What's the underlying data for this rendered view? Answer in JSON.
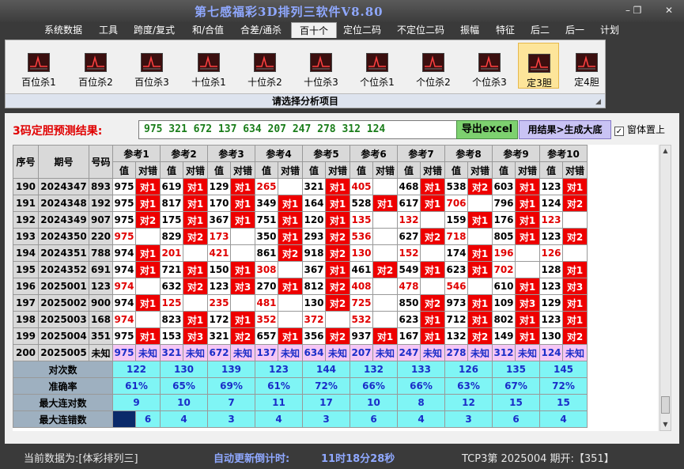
{
  "window": {
    "title": "第七感福彩3D排列三软件V8.80",
    "minimize": "–",
    "restore": "❐",
    "close": "✕"
  },
  "menu": [
    "系统数据",
    "工具",
    "跨度/复式",
    "和/合值",
    "合差/通杀",
    "百十个",
    "定位二码",
    "不定位二码",
    "振幅",
    "特征",
    "后二",
    "后一",
    "计划"
  ],
  "menu_active": 5,
  "tools": [
    "百位杀1",
    "百位杀2",
    "百位杀3",
    "十位杀1",
    "十位杀2",
    "十位杀3",
    "个位杀1",
    "个位杀2",
    "个位杀3",
    "定3胆",
    "定4胆"
  ],
  "tool_selected": 9,
  "toolbar_caption": "请选择分析项目",
  "prediction": {
    "label": "3码定胆预测结果:",
    "value": "975 321 672 137 634 207 247 278 312 124",
    "excel_button": "导出excel",
    "big_button": "用结果>生成大底",
    "pin_label": "窗体置上",
    "pin_checked": "✓"
  },
  "grid": {
    "headers": {
      "seq": "序号",
      "period": "期号",
      "number": "号码",
      "refs": [
        "参考1",
        "参考2",
        "参考3",
        "参考4",
        "参考5",
        "参考6",
        "参考7",
        "参考8",
        "参考9",
        "参考10"
      ],
      "val": "值",
      "hit": "对错"
    },
    "rows": [
      {
        "seq": "190",
        "period": "2024347",
        "number": "893",
        "cells": [
          [
            "975",
            "b",
            "对1",
            "r"
          ],
          [
            "619",
            "b",
            "对1",
            "r"
          ],
          [
            "129",
            "b",
            "对1",
            "r"
          ],
          [
            "265",
            "r",
            "",
            ""
          ],
          [
            "321",
            "b",
            "对1",
            "r"
          ],
          [
            "405",
            "r",
            "",
            ""
          ],
          [
            "468",
            "b",
            "对1",
            "r"
          ],
          [
            "538",
            "b",
            "对2",
            "r"
          ],
          [
            "603",
            "b",
            "对1",
            "r"
          ],
          [
            "123",
            "b",
            "对1",
            "r"
          ]
        ]
      },
      {
        "seq": "191",
        "period": "2024348",
        "number": "192",
        "cells": [
          [
            "975",
            "b",
            "对1",
            "r"
          ],
          [
            "817",
            "b",
            "对1",
            "r"
          ],
          [
            "170",
            "b",
            "对1",
            "r"
          ],
          [
            "349",
            "b",
            "对1",
            "r"
          ],
          [
            "164",
            "b",
            "对1",
            "r"
          ],
          [
            "528",
            "b",
            "对1",
            "r"
          ],
          [
            "617",
            "b",
            "对1",
            "r"
          ],
          [
            "706",
            "r",
            "",
            ""
          ],
          [
            "796",
            "b",
            "对1",
            "r"
          ],
          [
            "124",
            "b",
            "对2",
            "r"
          ]
        ]
      },
      {
        "seq": "192",
        "period": "2024349",
        "number": "907",
        "cells": [
          [
            "975",
            "b",
            "对2",
            "r"
          ],
          [
            "175",
            "b",
            "对1",
            "r"
          ],
          [
            "367",
            "b",
            "对1",
            "r"
          ],
          [
            "751",
            "b",
            "对1",
            "r"
          ],
          [
            "120",
            "b",
            "对1",
            "r"
          ],
          [
            "135",
            "r",
            "",
            ""
          ],
          [
            "132",
            "r",
            "",
            ""
          ],
          [
            "159",
            "b",
            "对1",
            "r"
          ],
          [
            "176",
            "b",
            "对1",
            "r"
          ],
          [
            "123",
            "r",
            "",
            ""
          ]
        ]
      },
      {
        "seq": "193",
        "period": "2024350",
        "number": "220",
        "cells": [
          [
            "975",
            "r",
            "",
            ""
          ],
          [
            "829",
            "b",
            "对2",
            "r"
          ],
          [
            "173",
            "r",
            "",
            ""
          ],
          [
            "350",
            "b",
            "对1",
            "r"
          ],
          [
            "293",
            "b",
            "对2",
            "r"
          ],
          [
            "536",
            "r",
            "",
            ""
          ],
          [
            "627",
            "b",
            "对2",
            "r"
          ],
          [
            "718",
            "r",
            "",
            ""
          ],
          [
            "805",
            "b",
            "对1",
            "r"
          ],
          [
            "123",
            "b",
            "对2",
            "r"
          ]
        ]
      },
      {
        "seq": "194",
        "period": "2024351",
        "number": "788",
        "cells": [
          [
            "974",
            "b",
            "对1",
            "r"
          ],
          [
            "201",
            "r",
            "",
            ""
          ],
          [
            "421",
            "r",
            "",
            ""
          ],
          [
            "861",
            "b",
            "对2",
            "r"
          ],
          [
            "918",
            "b",
            "对2",
            "r"
          ],
          [
            "130",
            "r",
            "",
            ""
          ],
          [
            "152",
            "r",
            "",
            ""
          ],
          [
            "174",
            "b",
            "对1",
            "r"
          ],
          [
            "196",
            "r",
            "",
            ""
          ],
          [
            "126",
            "r",
            "",
            ""
          ]
        ]
      },
      {
        "seq": "195",
        "period": "2024352",
        "number": "691",
        "cells": [
          [
            "974",
            "b",
            "对1",
            "r"
          ],
          [
            "721",
            "b",
            "对1",
            "r"
          ],
          [
            "150",
            "b",
            "对1",
            "r"
          ],
          [
            "308",
            "r",
            "",
            ""
          ],
          [
            "367",
            "b",
            "对1",
            "r"
          ],
          [
            "461",
            "b",
            "对2",
            "r"
          ],
          [
            "549",
            "b",
            "对1",
            "r"
          ],
          [
            "623",
            "b",
            "对1",
            "r"
          ],
          [
            "702",
            "r",
            "",
            ""
          ],
          [
            "128",
            "b",
            "对1",
            "r"
          ]
        ]
      },
      {
        "seq": "196",
        "period": "2025001",
        "number": "123",
        "cells": [
          [
            "974",
            "r",
            "",
            ""
          ],
          [
            "632",
            "b",
            "对2",
            "r"
          ],
          [
            "123",
            "b",
            "对3",
            "r"
          ],
          [
            "270",
            "b",
            "对1",
            "r"
          ],
          [
            "812",
            "b",
            "对2",
            "r"
          ],
          [
            "408",
            "r",
            "",
            ""
          ],
          [
            "478",
            "r",
            "",
            ""
          ],
          [
            "546",
            "r",
            "",
            ""
          ],
          [
            "610",
            "b",
            "对1",
            "r"
          ],
          [
            "123",
            "b",
            "对3",
            "r"
          ]
        ]
      },
      {
        "seq": "197",
        "period": "2025002",
        "number": "900",
        "cells": [
          [
            "974",
            "b",
            "对1",
            "r"
          ],
          [
            "125",
            "r",
            "",
            ""
          ],
          [
            "235",
            "r",
            "",
            ""
          ],
          [
            "481",
            "r",
            "",
            ""
          ],
          [
            "130",
            "b",
            "对2",
            "r"
          ],
          [
            "725",
            "r",
            "",
            ""
          ],
          [
            "850",
            "b",
            "对2",
            "r"
          ],
          [
            "973",
            "b",
            "对1",
            "r"
          ],
          [
            "109",
            "b",
            "对3",
            "r"
          ],
          [
            "129",
            "b",
            "对1",
            "r"
          ]
        ]
      },
      {
        "seq": "198",
        "period": "2025003",
        "number": "168",
        "cells": [
          [
            "974",
            "r",
            "",
            ""
          ],
          [
            "823",
            "b",
            "对1",
            "r"
          ],
          [
            "172",
            "b",
            "对1",
            "r"
          ],
          [
            "352",
            "r",
            "",
            ""
          ],
          [
            "372",
            "r",
            "",
            ""
          ],
          [
            "532",
            "r",
            "",
            ""
          ],
          [
            "623",
            "b",
            "对1",
            "r"
          ],
          [
            "712",
            "b",
            "对1",
            "r"
          ],
          [
            "802",
            "b",
            "对1",
            "r"
          ],
          [
            "123",
            "b",
            "对1",
            "r"
          ]
        ]
      },
      {
        "seq": "199",
        "period": "2025004",
        "number": "351",
        "cells": [
          [
            "975",
            "b",
            "对1",
            "r"
          ],
          [
            "153",
            "b",
            "对3",
            "r"
          ],
          [
            "321",
            "b",
            "对2",
            "r"
          ],
          [
            "657",
            "b",
            "对1",
            "r"
          ],
          [
            "356",
            "b",
            "对2",
            "r"
          ],
          [
            "937",
            "b",
            "对1",
            "r"
          ],
          [
            "167",
            "b",
            "对1",
            "r"
          ],
          [
            "132",
            "b",
            "对2",
            "r"
          ],
          [
            "149",
            "b",
            "对1",
            "r"
          ],
          [
            "130",
            "b",
            "对2",
            "r"
          ]
        ]
      }
    ],
    "pending": {
      "seq": "200",
      "period": "2025005",
      "number": "未知",
      "cells": [
        [
          "975",
          "未知"
        ],
        [
          "321",
          "未知"
        ],
        [
          "672",
          "未知"
        ],
        [
          "137",
          "未知"
        ],
        [
          "634",
          "未知"
        ],
        [
          "207",
          "未知"
        ],
        [
          "247",
          "未知"
        ],
        [
          "278",
          "未知"
        ],
        [
          "312",
          "未知"
        ],
        [
          "124",
          "未知"
        ]
      ]
    },
    "stats": [
      {
        "label": "对次数",
        "values": [
          "122",
          "130",
          "139",
          "123",
          "144",
          "132",
          "133",
          "126",
          "135",
          "145"
        ]
      },
      {
        "label": "准确率",
        "values": [
          "61%",
          "65%",
          "69%",
          "61%",
          "72%",
          "66%",
          "66%",
          "63%",
          "67%",
          "72%"
        ]
      },
      {
        "label": "最大连对数",
        "values": [
          "9",
          "10",
          "7",
          "11",
          "17",
          "10",
          "8",
          "12",
          "15",
          "15"
        ]
      },
      {
        "label": "最大连错数",
        "values": [
          "6",
          "4",
          "3",
          "4",
          "3",
          "6",
          "4",
          "3",
          "6",
          "4"
        ]
      }
    ]
  },
  "status": {
    "current_label": "当前数据为:[体彩排列三]",
    "countdown_label": "自动更新倒计时:",
    "countdown_value": "11时18分28秒",
    "draw_info": "TCP3第 2025004 期开:【351】"
  },
  "colors": {
    "hit_red": "#ee0000",
    "val_red": "#e00000",
    "blue": "#1a2dc8",
    "cyan": "#7ff5f5",
    "lavender": "#f5c6f5",
    "excel_green": "#7dd16f",
    "big_lavender": "#c9c3f4",
    "title_blue": "#8fa8ff",
    "prediction_green": "#1a7d1a"
  },
  "icons": {
    "tool": "trend-chart-icon",
    "grip": "resize-grip-icon",
    "scroll_up": "up-arrow-icon",
    "scroll_down": "down-arrow-icon"
  }
}
